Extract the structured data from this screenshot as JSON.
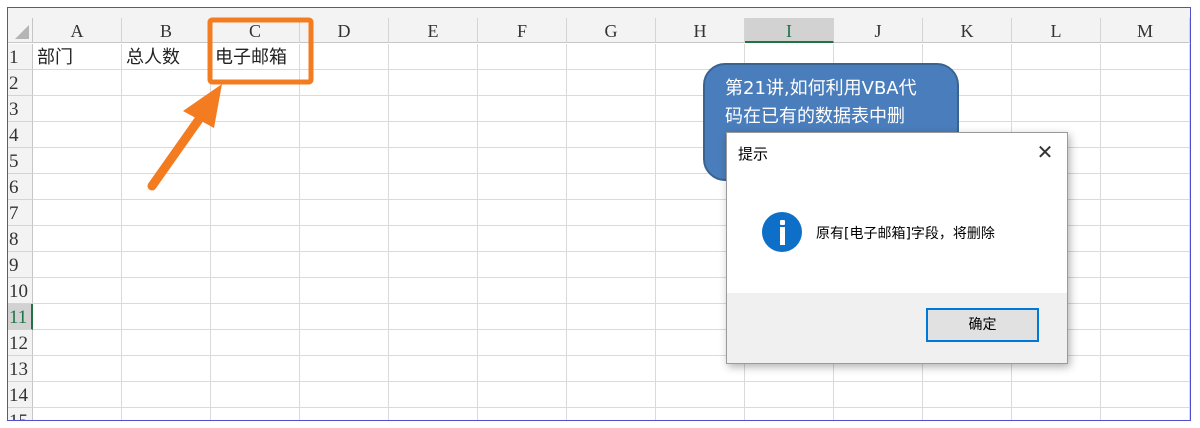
{
  "sheet": {
    "columns": [
      "A",
      "B",
      "C",
      "D",
      "E",
      "F",
      "G",
      "H",
      "I",
      "J",
      "K",
      "L",
      "M"
    ],
    "selected_column": "I",
    "rows": [
      "1",
      "2",
      "3",
      "4",
      "5",
      "6",
      "7",
      "8",
      "9",
      "10",
      "11",
      "12",
      "13",
      "14",
      "15"
    ],
    "selected_row": "11",
    "cells": {
      "A1": "部门",
      "B1": "总人数",
      "C1": "电子邮箱"
    }
  },
  "annotation": {
    "highlight_color": "#f47c20"
  },
  "callout": {
    "line1": "第21讲,如何利用VBA代",
    "line2": "码在已有的数据表中删"
  },
  "dialog": {
    "title": "提示",
    "close_icon": "close-icon",
    "icon": "info-icon",
    "message": "原有[电子邮箱]字段，将删除",
    "ok_label": "确定"
  }
}
